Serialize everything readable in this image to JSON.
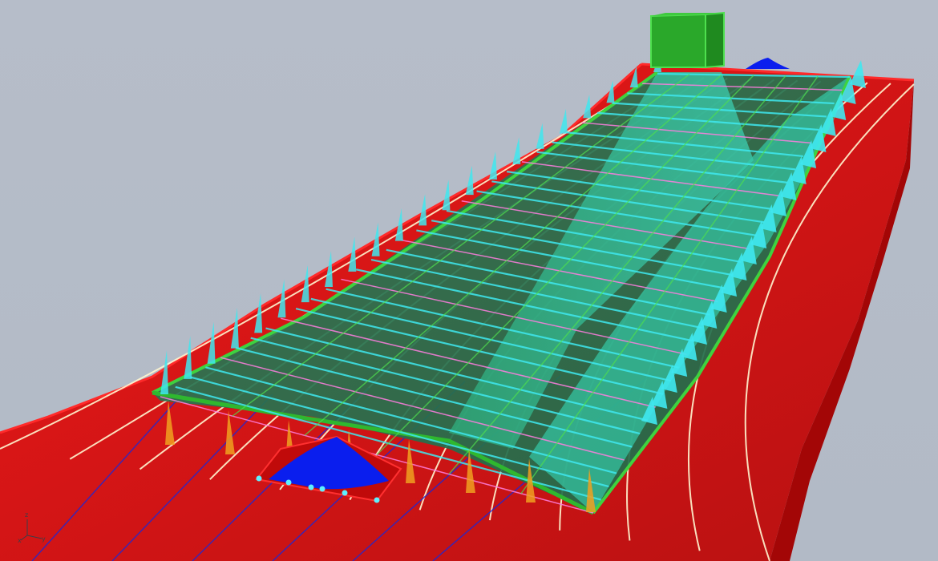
{
  "viewport": {
    "background": "#b4bcc8"
  },
  "model": {
    "hull_color": "#e00c0c",
    "hull_dark": "#8a0606",
    "frame_color": "#1f9a22",
    "frame_light": "#4ee04e",
    "bracket_color": "#3fe8ef",
    "bracket_orange": "#f0a020",
    "longitudinal_color": "#fff6d0",
    "pink_line_color": "#ff7ee0",
    "load_color": "#0a1eee",
    "node_color": "#5ef0ff",
    "edge_blue": "#1a28d8"
  },
  "axis_triad": {
    "x_label": "x",
    "y_label": "y",
    "z_label": "z"
  }
}
